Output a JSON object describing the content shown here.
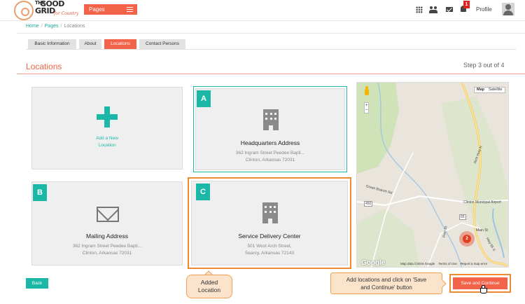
{
  "brand": {
    "line1": "THE",
    "line2": "GOOD",
    "line3": "GRID",
    "tagline": "for Country"
  },
  "header": {
    "pages_label": "Pages",
    "notification_count": "1",
    "profile_label": "Profile",
    "icons": [
      "grid-icon",
      "users-icon",
      "mail-icon",
      "bell-icon",
      "avatar"
    ]
  },
  "breadcrumb": {
    "home": "Home",
    "pages": "Pages",
    "current": "Locations",
    "separator": "/"
  },
  "tabs": [
    {
      "label": "Basic Information",
      "active": false
    },
    {
      "label": "About",
      "active": false
    },
    {
      "label": "Locations",
      "active": true
    },
    {
      "label": "Contact Persons",
      "active": false
    }
  ],
  "section": {
    "title": "Locations",
    "step": "Step 3 out of 4"
  },
  "cards": {
    "add": {
      "line1": "Add a New",
      "line2": "Location"
    },
    "headquarters": {
      "letter": "A",
      "title": "Headquarters Address",
      "addr1": "362 Ingram Street Peedee Bapti...",
      "addr2": "Clinton, Arkansas 72031"
    },
    "mailing": {
      "letter": "B",
      "title": "Mailing Address",
      "addr1": "362 Ingram Street Peedee Bapti...",
      "addr2": "Clinton, Arkansas 72031"
    },
    "service": {
      "letter": "C",
      "title": "Service Delivery Center",
      "addr1": "501 West Arch Street,",
      "addr2": "Searcy, Arkansas 72143"
    }
  },
  "map": {
    "type_map": "Map",
    "type_satellite": "Satellite",
    "zoom_in": "+",
    "zoom_out": "−",
    "labels": {
      "highway": "Arch Hwy N",
      "creek": "Green Branch Rd",
      "city": "Clinton Municipal Airport",
      "road1": "450",
      "road2": "65",
      "main_st": "Main St",
      "hwy_s": "Hwy 65 S",
      "pole": "Pole St",
      "marker_count": "2"
    },
    "google": "Google",
    "footer": {
      "data": "Map data ©2015 Google",
      "terms": "Terms of Use",
      "report": "Report a map error"
    }
  },
  "actions": {
    "back": "Back",
    "save": "Save and Continue"
  },
  "callouts": {
    "added": {
      "line1": "Added",
      "line2": "Location"
    },
    "instruction": {
      "line1": "Add locations and click on 'Save",
      "line2": "and Continue' button"
    }
  },
  "colors": {
    "accent": "#f2634a",
    "teal": "#1bb8a8",
    "callout_border": "#f08a30"
  }
}
